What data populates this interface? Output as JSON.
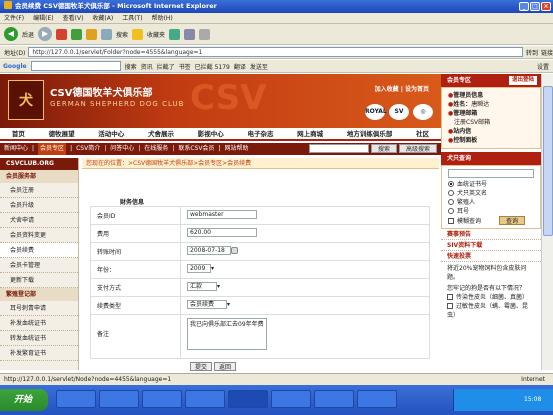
{
  "window": {
    "title": "会员续费 CSV德国牧羊犬俱乐部 - Microsoft Internet Explorer"
  },
  "menubar": [
    "文件(F)",
    "编辑(E)",
    "查看(V)",
    "收藏(A)",
    "工具(T)",
    "帮助(H)"
  ],
  "toolbar": {
    "back": "后退",
    "search": "搜索",
    "favorites": "收藏夹"
  },
  "address": {
    "label": "地址(D)",
    "url": "http://127.0.0.1/servlet/Folder?node=4555&language=1",
    "go": "转到",
    "links": "链接"
  },
  "googlebar": {
    "label": "Google",
    "search": "搜索",
    "items": [
      "资讯",
      "拦截了",
      "书签",
      "已拦截 5179",
      "翻译",
      "发送至"
    ],
    "settings": "设置"
  },
  "banner": {
    "cn": "CSV德国牧羊犬俱乐部",
    "en": "GERMAN SHEPHERD DOG CLUB",
    "join": "加入收藏",
    "home": "设为首页",
    "big": "CSV",
    "sponsors": [
      "ROYAL",
      "SV",
      "◎"
    ]
  },
  "nav": [
    "首页",
    "德牧展望",
    "活动中心",
    "犬舍展示",
    "影视中心",
    "电子杂志",
    "网上商城",
    "地方训练俱乐部",
    "社区"
  ],
  "subnav": {
    "items": [
      "新闻中心",
      "会员专区",
      "CSV简介",
      "问答中心",
      "在线服务",
      "联系CSV会员",
      "网站帮助"
    ],
    "active": 1,
    "search_btn": "搜索",
    "adv_search": "高级搜索"
  },
  "sidebar": {
    "header": "CSVCLUB.ORG",
    "group1": "会员服务部",
    "items1": [
      "会员注册",
      "会员升级",
      "犬舍申请",
      "会员资料变更",
      "会员续费",
      "会员卡管理",
      "更新下载"
    ],
    "active": 4,
    "group2": "繁殖登记部",
    "items2": [
      "耳号刺青申请",
      "补发血统证书",
      "转发血统证书",
      "补发繁育证书"
    ]
  },
  "crumb": "您现在的位置：>CSV德国牧羊犬俱乐部>会员专区>会员续费",
  "form": {
    "title": "财务信息",
    "rows": [
      {
        "label": "会员ID",
        "value": "webmaster",
        "kind": "input"
      },
      {
        "label": "费用",
        "value": "620.00",
        "kind": "input"
      },
      {
        "label": "转账时间",
        "value": "2008-07-18",
        "kind": "input"
      },
      {
        "label": "年份：",
        "value": "2009",
        "kind": "select"
      },
      {
        "label": "支付方式",
        "value": "汇款",
        "kind": "select"
      },
      {
        "label": "续费类型",
        "value": "会员续费",
        "kind": "select"
      },
      {
        "label": "备注",
        "value": "我已向俱乐部汇去09年年费",
        "kind": "textarea"
      }
    ],
    "submit": "提交",
    "back": "返回"
  },
  "right": {
    "header": "会员专区",
    "logout": "退出登陆",
    "items": [
      [
        "管理员信息",
        ""
      ],
      [
        "姓名：",
        "唐瞬达"
      ],
      [
        "管理邮箱",
        ""
      ],
      [
        "注册CSV邮箱",
        ""
      ],
      [
        "站内信",
        ""
      ],
      [
        "控制面板",
        ""
      ]
    ],
    "header2": "犬只查询",
    "options": [
      "血统证书号",
      "犬只英文名",
      "繁殖人",
      "耳号"
    ],
    "selected": 0,
    "fuzzy": "模糊查询",
    "query": "查询",
    "sections": [
      "赛事预告",
      "SIV资料下载",
      "快速投票"
    ],
    "vote_text": "将近20%宠物饲料包含皮肤问题。",
    "vote_q": "您牢记的狗是否有以下情况？",
    "vote_opts": [
      "传染性皮炎（细菌、真菌）",
      "过敏性皮炎（螨、霉菌、昆虫）"
    ]
  },
  "status": {
    "url": "http://127.0.0.1/servlet/Node?node=4455&language=1",
    "zone": "Internet"
  },
  "taskbar": {
    "start": "开始",
    "time": "15:08"
  }
}
